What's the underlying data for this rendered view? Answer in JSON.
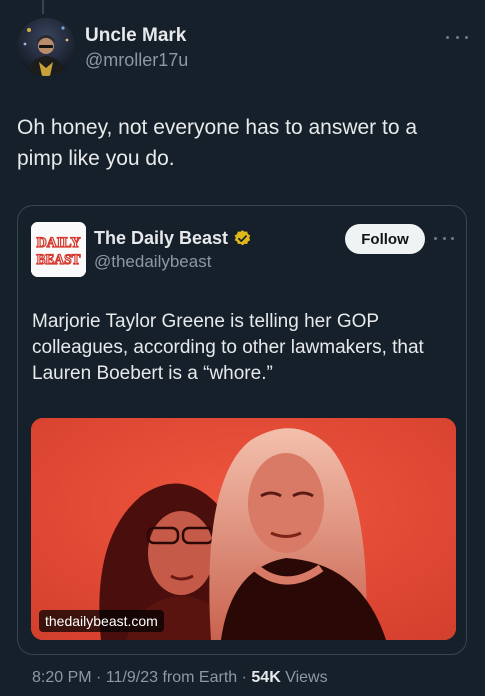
{
  "tweet": {
    "author_name": "Uncle Mark",
    "author_handle": "@mroller17u",
    "text": "Oh honey, not everyone has to answer to a pimp like you do.",
    "time": "8:20 PM",
    "date": "11/9/23",
    "source": "from Earth",
    "views_count": "54K",
    "views_label": "Views",
    "separator": "·"
  },
  "quote": {
    "avatar_logo_line1": "DAILY",
    "avatar_logo_line2": "BEAST",
    "name": "The Daily Beast",
    "handle": "@thedailybeast",
    "follow_label": "Follow",
    "text": "Marjorie Taylor Greene is telling her GOP colleagues, according to other lawmakers, that Lauren Boebert is a “whore.”",
    "media_domain": "thedailybeast.com"
  },
  "colors": {
    "background": "#15202b",
    "secondary_text": "#8b98a5",
    "verified_badge": "#e2b719",
    "media_red": "#e24a35"
  }
}
